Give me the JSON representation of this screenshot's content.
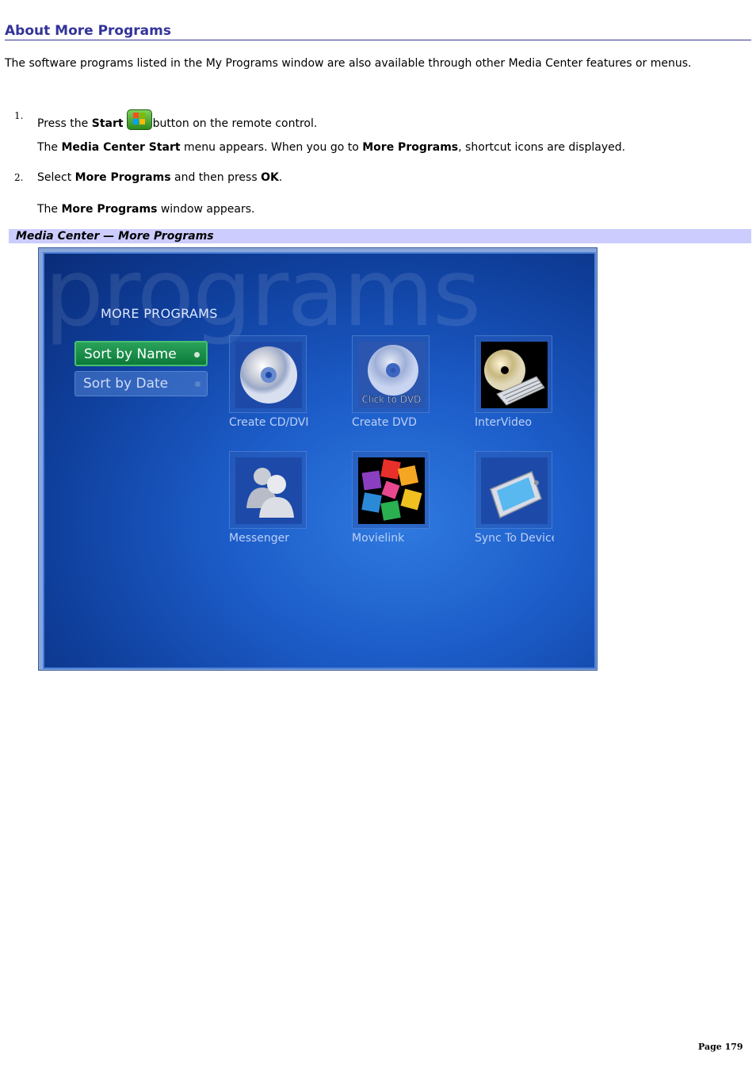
{
  "heading": "About More Programs",
  "intro": "The software programs listed in the My Programs window are also available through other Media Center features or menus.",
  "steps": [
    {
      "number": "1.",
      "text_before": "Press the ",
      "bold": "Start",
      "text_after": "button on the remote control.",
      "note_prefix": "The ",
      "note_bold1": "Media Center Start",
      "note_mid": " menu appears. When you go to ",
      "note_bold2": "More Programs",
      "note_suffix": ", shortcut icons are displayed."
    },
    {
      "number": "2.",
      "text_before": "Select ",
      "bold": "More Programs",
      "text_mid": " and then press ",
      "bold2": "OK",
      "text_after": ".",
      "note_prefix": "The ",
      "note_bold": "More Programs",
      "note_suffix": " window appears."
    }
  ],
  "caption": "Media Center — More Programs",
  "screen": {
    "background_word": "programs",
    "title": "MORE PROGRAMS",
    "sort_options": [
      "Sort by Name",
      "Sort by Date"
    ],
    "tiles": [
      {
        "label": "Create CD/DVI",
        "icon": "cd-icon"
      },
      {
        "label": "Create DVD",
        "icon": "click-to-dvd-icon",
        "art_text": "Click to DVD"
      },
      {
        "label": "InterVideo",
        "icon": "cd-keyboard-icon"
      },
      {
        "label": "Messenger",
        "icon": "messenger-icon"
      },
      {
        "label": "Movielink",
        "icon": "movielink-icon"
      },
      {
        "label": "Sync To Device",
        "icon": "pda-device-icon"
      }
    ]
  },
  "page_number": "Page 179",
  "colors": {
    "heading": "#333399",
    "caption_bg": "#ccccff"
  }
}
